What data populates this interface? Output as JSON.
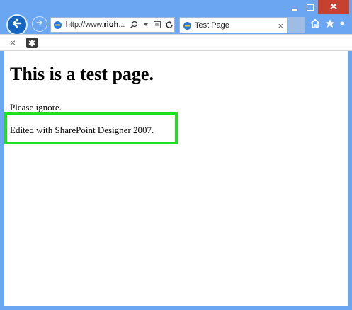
{
  "browser": {
    "address_url_prefix": "http://www.",
    "address_url_bold": "rioh",
    "address_url_suffix": "...",
    "tab_title": "Test Page",
    "tab_close": "×",
    "cmd_close": "×",
    "colors": {
      "frame": "#6aa6f2",
      "close_button": "#c7412f",
      "back_button": "#1565c0",
      "highlight_border": "#1fe01f"
    },
    "icons": {
      "minimize": "minimize-icon",
      "maximize": "maximize-icon",
      "close": "close-icon",
      "back": "back-arrow-icon",
      "forward": "forward-arrow-icon",
      "page": "ie-page-icon",
      "search": "search-icon",
      "dropdown": "dropdown-arrow-icon",
      "compat": "compatibility-view-icon",
      "refresh": "refresh-icon",
      "home": "home-icon",
      "favorites": "star-icon",
      "tools": "gear-icon",
      "extension": "extension-icon"
    }
  },
  "page": {
    "heading": "This is a test page.",
    "paragraph1": "Please ignore.",
    "paragraph2": "Edited with SharePoint Designer 2007."
  }
}
